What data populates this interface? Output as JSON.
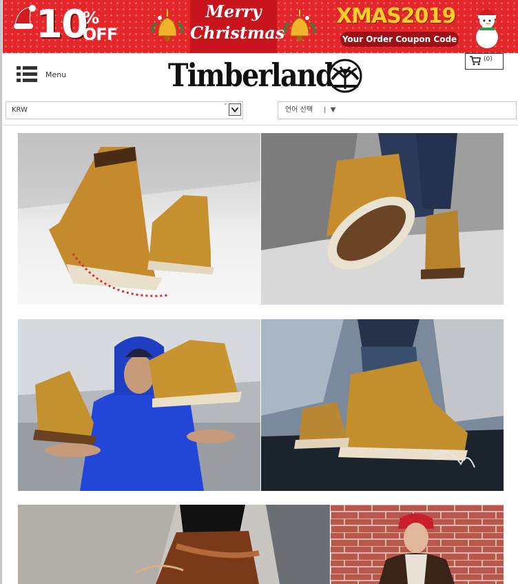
{
  "banner": {
    "discount": "10",
    "percent_sign": "%",
    "off_label": "OFF",
    "greeting_line1": "Merry",
    "greeting_line2": "Christmas",
    "promo_title": "XMAS2019",
    "promo_subtitle": "Your Order Coupon Code",
    "colors": {
      "background": "#e3262a",
      "accent": "#ffcc29",
      "pill": "#9d1016"
    }
  },
  "header": {
    "menu_label": "Menu",
    "brand": "Timberland",
    "cart_count": "(0)"
  },
  "selectors": {
    "currency": "KRW",
    "language_placeholder": "언어 선택"
  },
  "icons": [
    "santa-hat-icon",
    "bell-ornament-icon",
    "snowman-icon",
    "hamburger-menu-icon",
    "tree-logo-icon",
    "cart-icon",
    "chevron-down-icon"
  ],
  "gallery": {
    "photos": [
      "boots-studio",
      "boot-sole-step",
      "man-holding-boots",
      "boot-puddle-splash",
      "boot-laces-closeup",
      "woman-brick-wall"
    ]
  }
}
